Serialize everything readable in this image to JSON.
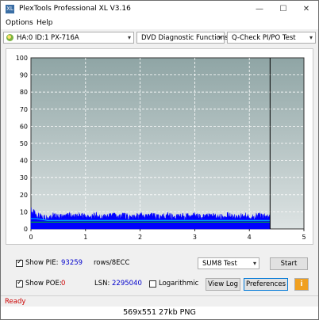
{
  "window": {
    "title": "PlexTools Professional XL V3.16",
    "minimize": "—",
    "maximize": "☐",
    "close": "✕"
  },
  "menu": [
    "Options",
    "Help"
  ],
  "toolbar": {
    "drive": "HA:0 ID:1  PX-716A",
    "function": "DVD Diagnostic Functions",
    "test": "Q-Check PI/PO Test"
  },
  "chart_data": {
    "type": "area",
    "xlim": [
      0,
      5
    ],
    "ylim": [
      0,
      100
    ],
    "x_ticks": [
      "0",
      "1",
      "2",
      "3",
      "4",
      "5"
    ],
    "y_ticks": [
      "0",
      "10",
      "20",
      "30",
      "40",
      "50",
      "60",
      "70",
      "80",
      "90",
      "100"
    ],
    "grid": true,
    "end_marker_x": 4.38,
    "series": [
      {
        "color": "#0000ff",
        "x": [
          0,
          0.1,
          0.2,
          0.3,
          0.4,
          0.5,
          0.6,
          0.7,
          0.8,
          0.9,
          1.0,
          1.1,
          1.2,
          1.3,
          1.4,
          1.5,
          1.6,
          1.7,
          1.8,
          1.9,
          2.0,
          2.1,
          2.2,
          2.3,
          2.4,
          2.5,
          2.6,
          2.7,
          2.8,
          2.9,
          3.0,
          3.1,
          3.2,
          3.3,
          3.4,
          3.5,
          3.6,
          3.7,
          3.8,
          3.9,
          4.0,
          4.1,
          4.2,
          4.3,
          4.38
        ],
        "values": [
          12,
          9,
          8,
          8,
          9,
          8,
          8,
          9,
          8,
          9,
          8,
          8,
          9,
          8,
          8,
          9,
          8,
          9,
          8,
          8,
          9,
          8,
          9,
          8,
          8,
          9,
          8,
          8,
          9,
          8,
          9,
          8,
          8,
          9,
          8,
          8,
          9,
          8,
          8,
          9,
          8,
          8,
          9,
          8,
          8
        ]
      },
      {
        "color": "#00d000",
        "x": [
          0,
          0.5,
          1.0,
          1.5,
          2.0,
          2.5,
          3.0,
          3.5,
          4.0,
          4.38
        ],
        "values": [
          4,
          4,
          4,
          4,
          4,
          4,
          4,
          4,
          4,
          4
        ]
      },
      {
        "color": "#00c8ff",
        "x": [
          0,
          0.1,
          0.2,
          0.3,
          0.5,
          1.0,
          1.5,
          2.0,
          2.5,
          3.0,
          3.5,
          4.0,
          4.38
        ],
        "values": [
          6,
          6,
          5.5,
          5,
          5,
          5,
          5,
          5,
          5,
          5,
          5,
          5,
          5
        ]
      }
    ]
  },
  "controls": {
    "show_pie_label": "Show PIE:",
    "pie_value": "93259",
    "rows_label": "rows/8ECC",
    "show_poe_label": "Show POE:",
    "poe_value": "0",
    "lsn_label": "LSN:",
    "lsn_value": "2295040",
    "log_label": "Logarithmic",
    "test_select": "SUM8 Test",
    "start": "Start",
    "view_log": "View Log",
    "preferences": "Preferences",
    "info_icon": "i"
  },
  "status": "Ready",
  "caption": "569x551  27kb  PNG",
  "colors": {
    "chart_bg_top": "#8fa5a5",
    "chart_bg_bottom": "#dde3e3",
    "pi_bar": "#0000ff",
    "status_text": "#cc0000"
  }
}
